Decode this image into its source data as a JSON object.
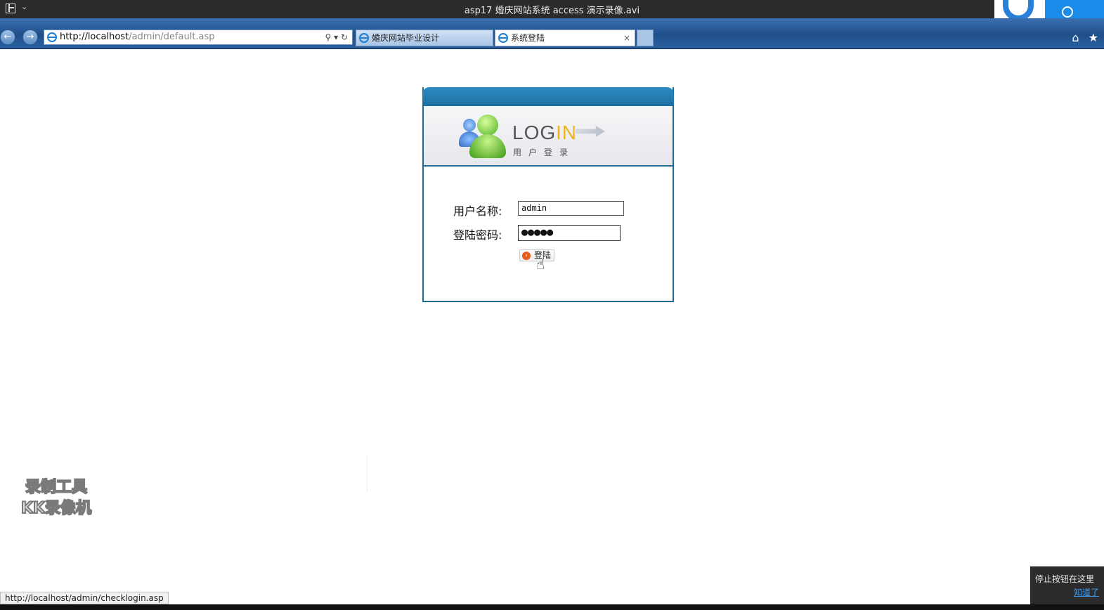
{
  "player": {
    "title": "asp17 婚庆网站系统 access 演示录像.avi"
  },
  "browser": {
    "address": {
      "url_host": "http://localhost",
      "url_rest": "/admin/default.asp"
    },
    "tabs": [
      {
        "label": "婚庆网站毕业设计",
        "active": false
      },
      {
        "label": "系统登陆",
        "active": true
      }
    ],
    "icons": {
      "back": "back-arrow-icon",
      "forward": "forward-arrow-icon",
      "home": "home-icon",
      "favorites": "star-icon"
    }
  },
  "login": {
    "logo_main": "LOG",
    "logo_accent": "IN",
    "logo_sub": "用户登录",
    "username_label": "用户名称:",
    "password_label": "登陆密码:",
    "username_value": "admin",
    "password_value": "●●●●●",
    "submit_label": "登陆"
  },
  "watermark": {
    "line1": "录制工具",
    "line2": "KK录像机"
  },
  "status": {
    "hover_url": "http://localhost/admin/checklogin.asp"
  },
  "tip": {
    "text": "停止按钮在这里",
    "link": "知道了"
  },
  "colors": {
    "panel_border": "#1f6b94",
    "logo_accent": "#f0b11d",
    "browser_chrome": "#1f4f8a"
  }
}
